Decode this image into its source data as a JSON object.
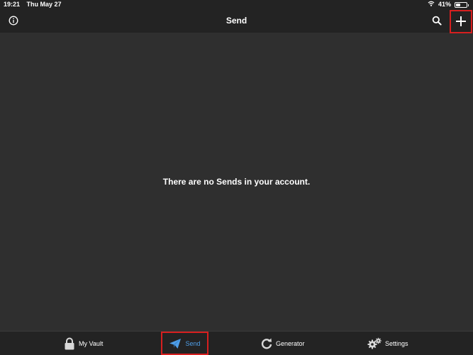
{
  "status_bar": {
    "time": "19:21",
    "date": "Thu May 27",
    "battery_percent": "41%",
    "battery_level": 0.41
  },
  "nav": {
    "title": "Send",
    "info_icon": "info-icon",
    "search_icon": "search-icon",
    "add_icon": "plus-icon"
  },
  "main": {
    "empty_message": "There are no Sends in your account."
  },
  "tabs": [
    {
      "label": "My Vault",
      "icon": "lock-icon"
    },
    {
      "label": "Send",
      "icon": "paper-plane-icon",
      "active": true
    },
    {
      "label": "Generator",
      "icon": "refresh-icon"
    },
    {
      "label": "Settings",
      "icon": "gears-icon"
    }
  ],
  "colors": {
    "background": "#2f2f2f",
    "bars": "#232323",
    "accent": "#4f9fe8",
    "highlight": "#d71f1f"
  }
}
